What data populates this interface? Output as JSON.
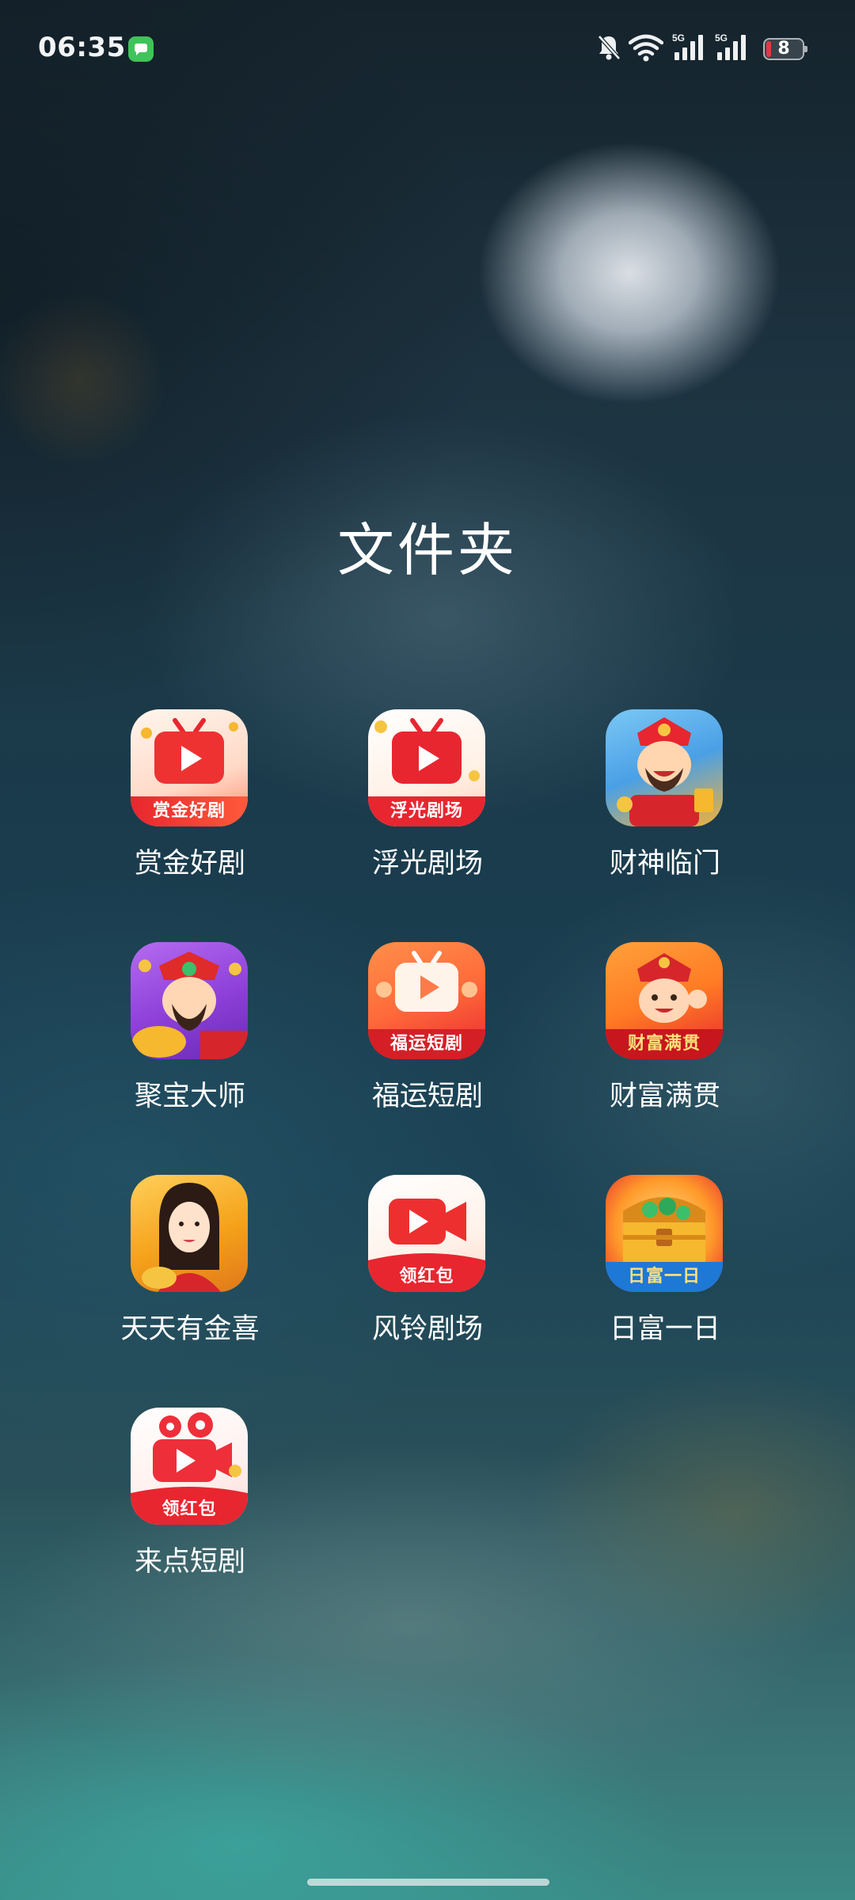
{
  "status_bar": {
    "time": "06:35",
    "battery_level": "8",
    "signal_label_1": "5G",
    "signal_label_2": "5G",
    "notification_icon": "messages-icon",
    "icons": [
      "bell-muted-icon",
      "wifi-icon",
      "signal-5g-icon",
      "signal-5g-icon",
      "battery-icon"
    ]
  },
  "folder": {
    "title": "文件夹"
  },
  "apps": [
    {
      "label": "赏金好剧",
      "icon": "red-tv-play-icon",
      "banner": "赏金好剧"
    },
    {
      "label": "浮光剧场",
      "icon": "red-tv-play-icon",
      "banner": "浮光剧场"
    },
    {
      "label": "财神临门",
      "icon": "god-of-wealth-icon",
      "banner": ""
    },
    {
      "label": "聚宝大师",
      "icon": "god-of-wealth-gold-icon",
      "banner": ""
    },
    {
      "label": "福运短剧",
      "icon": "tv-play-icon",
      "banner": "福运短剧"
    },
    {
      "label": "财富满贯",
      "icon": "lucky-boy-icon",
      "banner": "财富满贯"
    },
    {
      "label": "天天有金喜",
      "icon": "lady-portrait-icon",
      "banner": ""
    },
    {
      "label": "风铃剧场",
      "icon": "video-camera-icon",
      "banner": "领红包"
    },
    {
      "label": "日富一日",
      "icon": "treasure-chest-icon",
      "banner": "日富一日"
    },
    {
      "label": "来点短剧",
      "icon": "movie-camera-icon",
      "banner": "领红包"
    }
  ],
  "colors": {
    "accent_red": "#e8262f",
    "gold": "#f5b82e",
    "battery_low": "#e0393e"
  }
}
